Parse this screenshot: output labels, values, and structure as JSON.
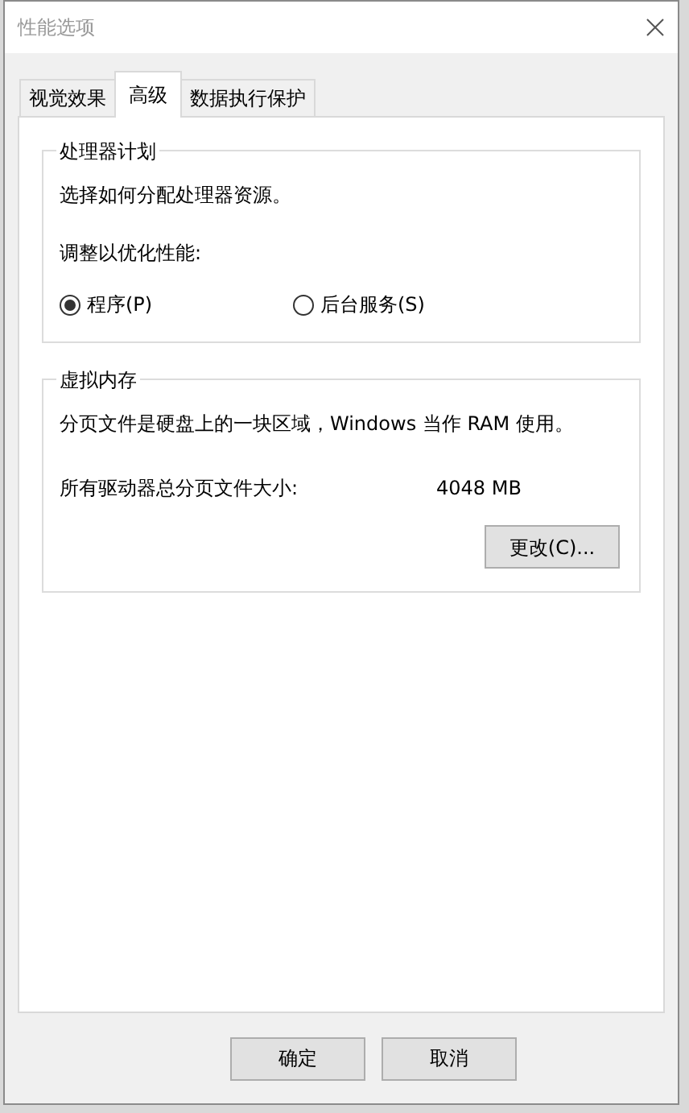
{
  "window": {
    "title": "性能选项"
  },
  "tabs": [
    {
      "label": "视觉效果",
      "selected": false
    },
    {
      "label": "高级",
      "selected": true
    },
    {
      "label": "数据执行保护",
      "selected": false
    }
  ],
  "processor_scheduling": {
    "title": "处理器计划",
    "description": "选择如何分配处理器资源。",
    "prompt": "调整以优化性能:",
    "options": [
      {
        "label": "程序(P)",
        "selected": true
      },
      {
        "label": "后台服务(S)",
        "selected": false
      }
    ]
  },
  "virtual_memory": {
    "title": "虚拟内存",
    "description": "分页文件是硬盘上的一块区域，Windows 当作 RAM 使用。",
    "size_label": "所有驱动器总分页文件大小:",
    "size_value": "4048 MB",
    "change_button": "更改(C)..."
  },
  "buttons": [
    "确定",
    "取消"
  ]
}
